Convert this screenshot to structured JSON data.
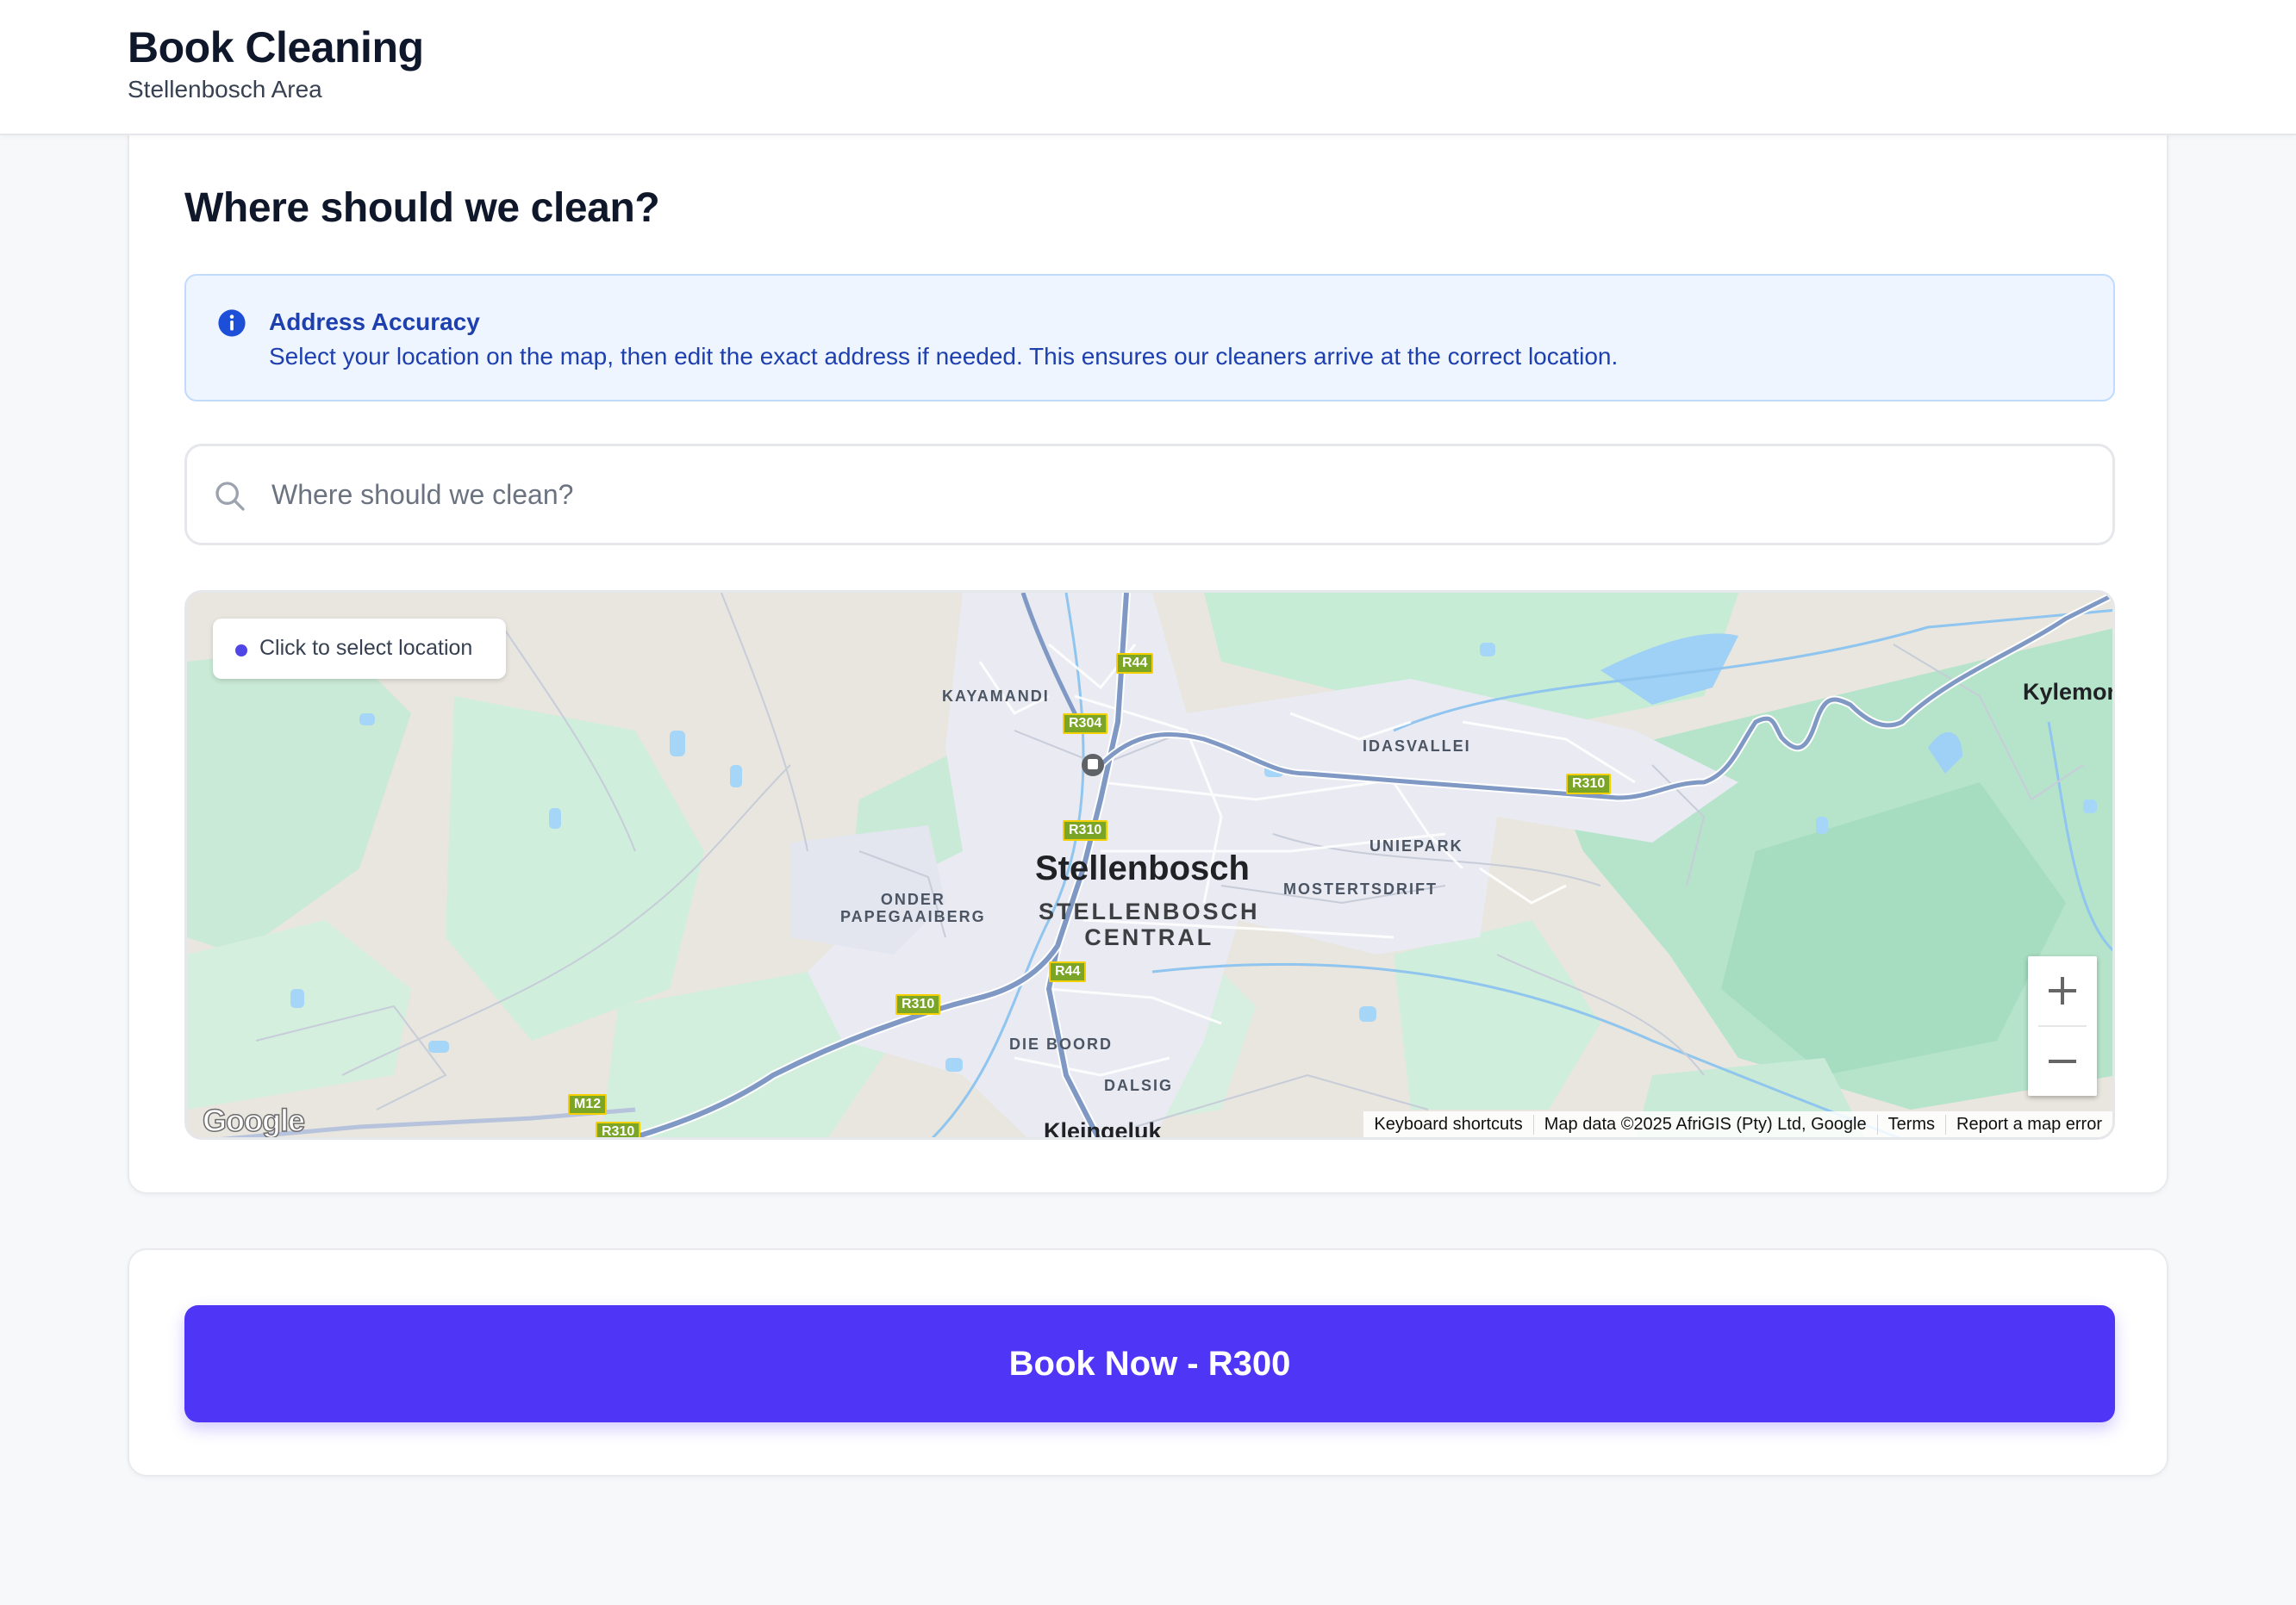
{
  "header": {
    "title": "Book Cleaning",
    "subtitle": "Stellenbosch Area"
  },
  "location": {
    "heading": "Where should we clean?",
    "info": {
      "icon": "info-icon",
      "title": "Address Accuracy",
      "text": "Select your location on the map, then edit the exact address if needed. This ensures our cleaners arrive at the correct location."
    },
    "search": {
      "icon": "search-icon",
      "placeholder": "Where should we clean?",
      "value": ""
    }
  },
  "map": {
    "hint": "Click to select location",
    "labels": {
      "city": "Stellenbosch",
      "central_1": "STELLENBOSCH",
      "central_2": "CENTRAL",
      "kayamandi": "KAYAMANDI",
      "idasvallei": "IDASVALLEI",
      "uniepark": "UNIEPARK",
      "mostertsdrift": "MOSTERTSDRIFT",
      "onder_1": "ONDER",
      "onder_2": "PAPEGAAIBERG",
      "die_boord": "DIE BOORD",
      "dalsig": "DALSIG",
      "kleingeluk": "Kleingeluk",
      "kylemor": "Kylemor"
    },
    "routes": {
      "r44_top": "R44",
      "r304": "R304",
      "r310_center": "R310",
      "r310_east": "R310",
      "r44_south": "R44",
      "r310_west": "R310",
      "m12": "M12",
      "r310_bottom": "R310"
    },
    "zoom_in": "+",
    "zoom_out": "−",
    "logo": "Google",
    "attribution": {
      "shortcuts": "Keyboard shortcuts",
      "data": "Map data ©2025 AfriGIS (Pty) Ltd, Google",
      "terms": "Terms",
      "report": "Report a map error"
    }
  },
  "booking": {
    "button_label": "Book Now - R300"
  },
  "colors": {
    "primary": "#4f35f6",
    "info_bg": "#eef5ff",
    "info_text": "#1e40af"
  }
}
